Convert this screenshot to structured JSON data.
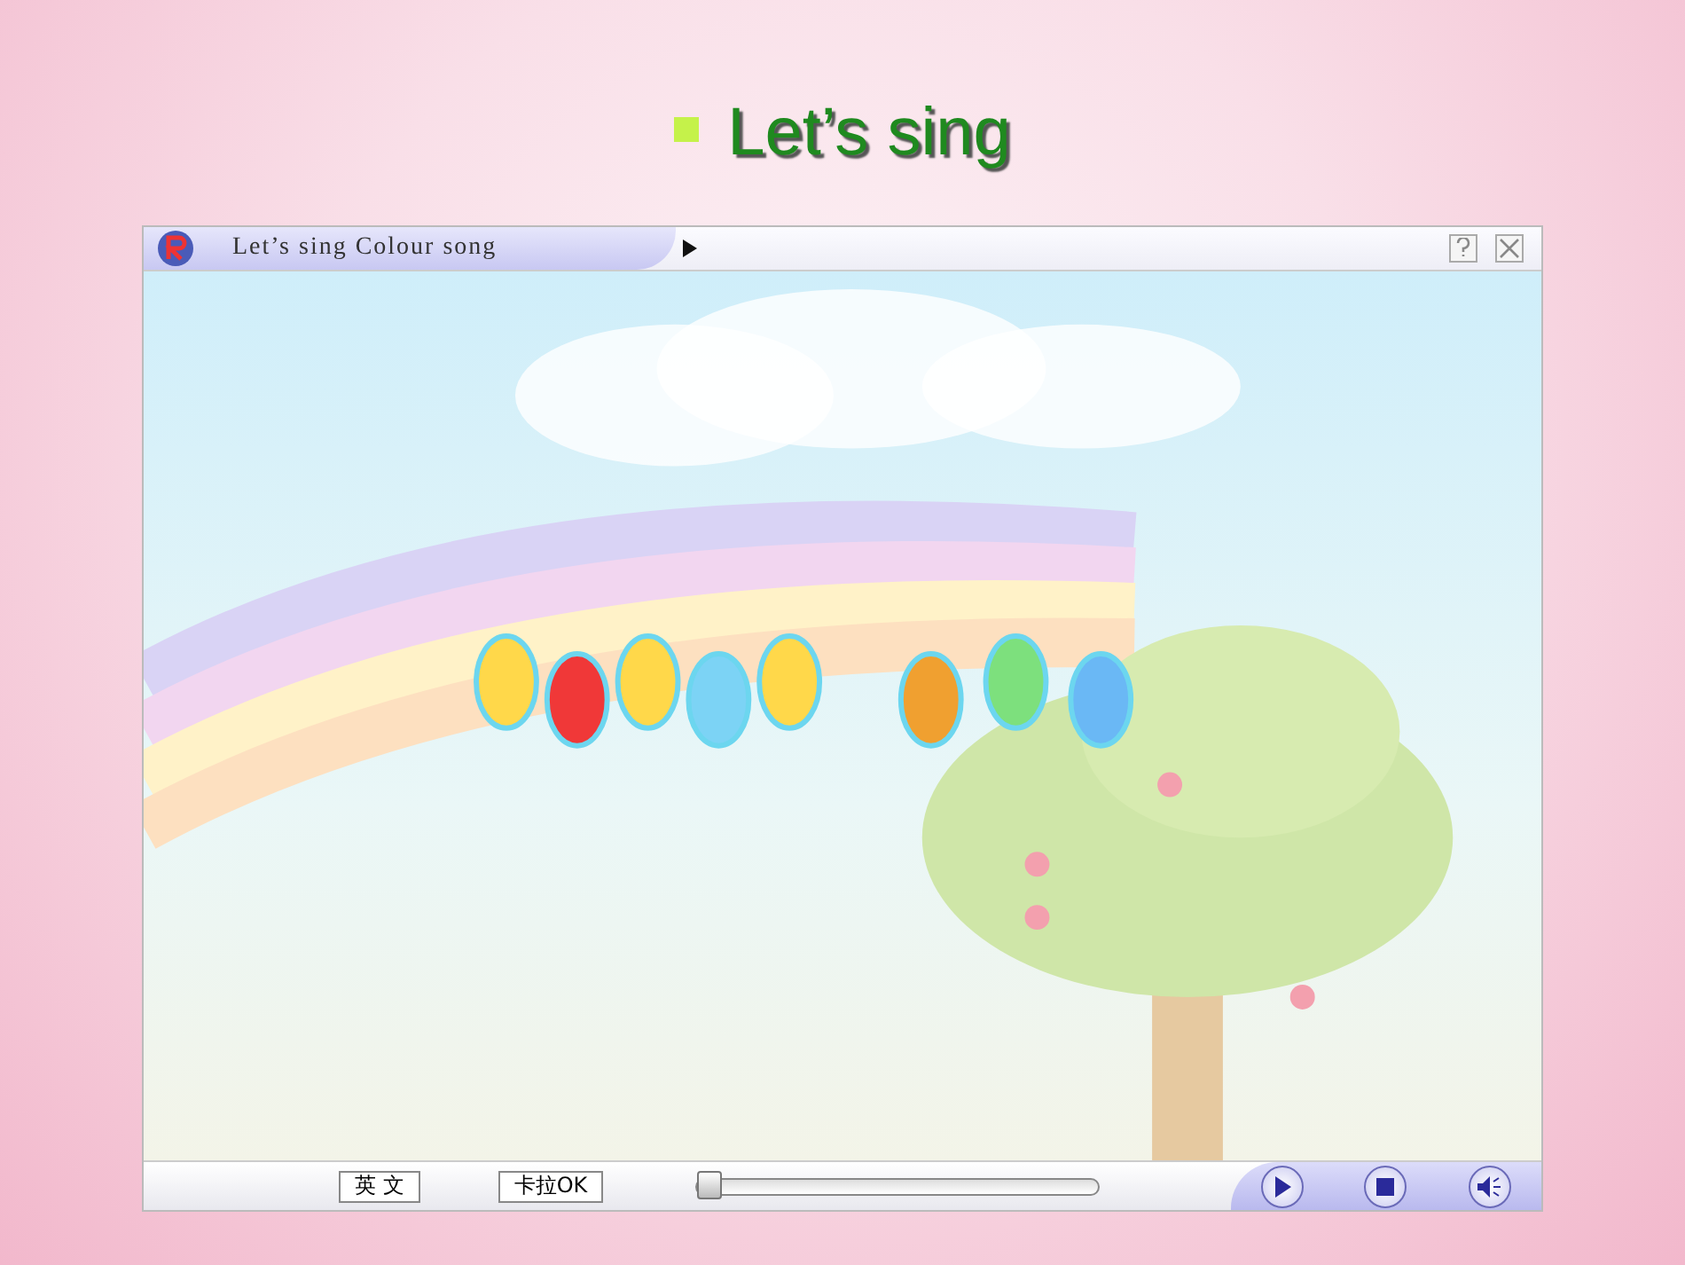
{
  "heading": "Let’s sing",
  "player": {
    "title": "Let’s sing Colour song",
    "buttons": [
      {
        "label": "英 文"
      },
      {
        "label": "卡拉OK"
      }
    ],
    "progress": {
      "level": 0
    }
  }
}
